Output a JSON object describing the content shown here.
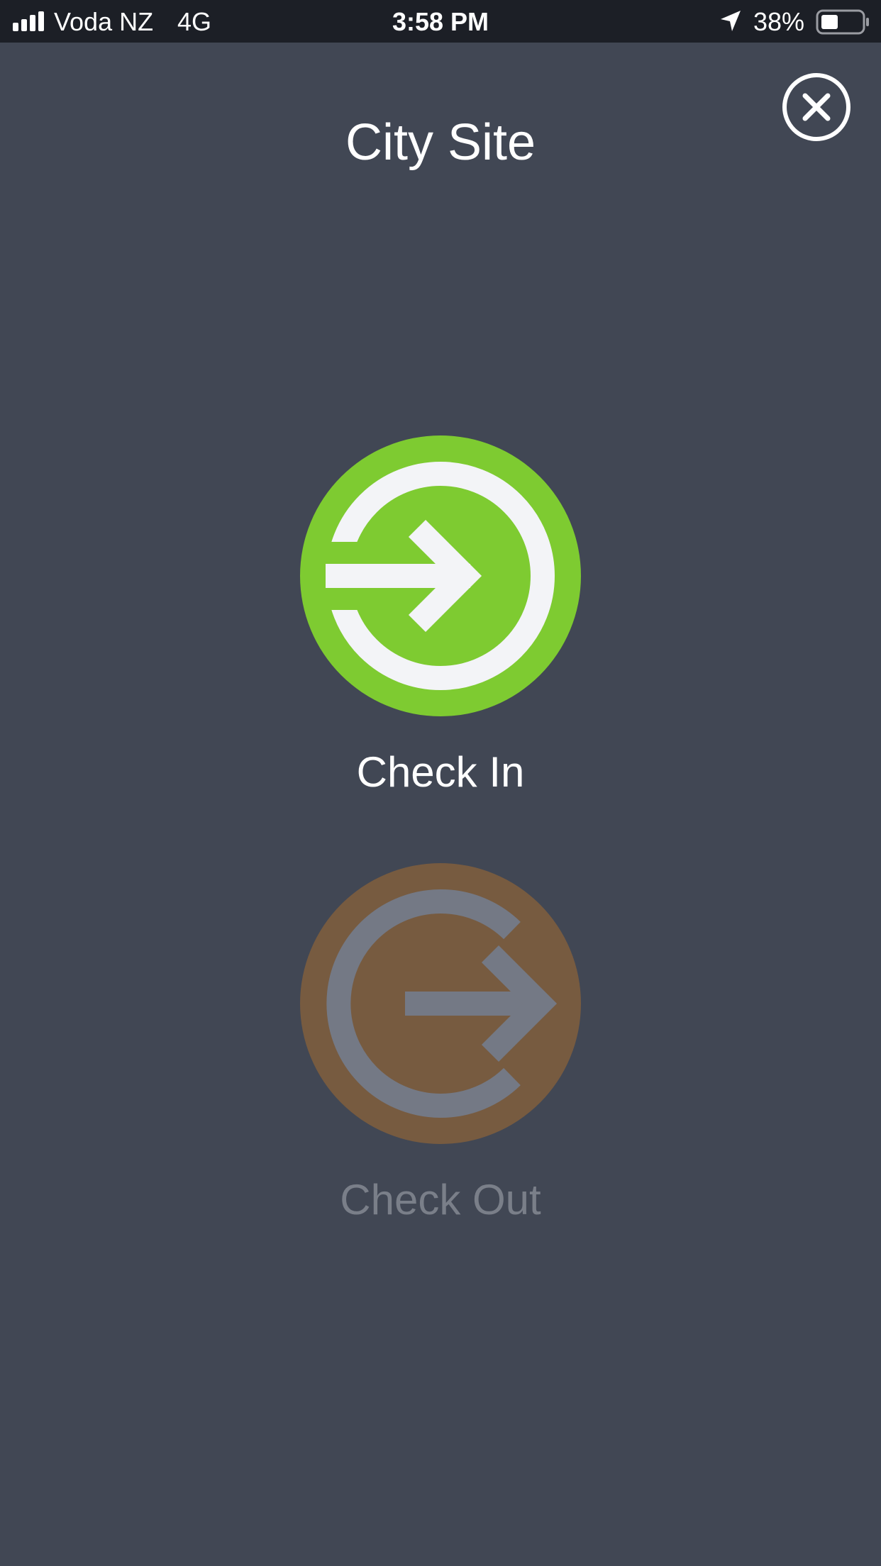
{
  "status_bar": {
    "carrier": "Voda NZ",
    "network": "4G",
    "time": "3:58 PM",
    "battery_percent": "38%",
    "icons": [
      "signal-icon",
      "location-arrow-icon",
      "battery-icon"
    ]
  },
  "header": {
    "title": "City Site",
    "close_icon": "close-icon"
  },
  "actions": {
    "check_in": {
      "label": "Check In",
      "icon": "check-in-icon",
      "color": "#7ecb31"
    },
    "check_out": {
      "label": "Check Out",
      "icon": "check-out-icon",
      "color": "#775b40"
    }
  },
  "colors": {
    "background": "#414754",
    "status_bar": "#1c1f26",
    "icon_light": "#f3f4f7",
    "icon_muted": "#747985",
    "label_muted": "#7a7f89"
  }
}
